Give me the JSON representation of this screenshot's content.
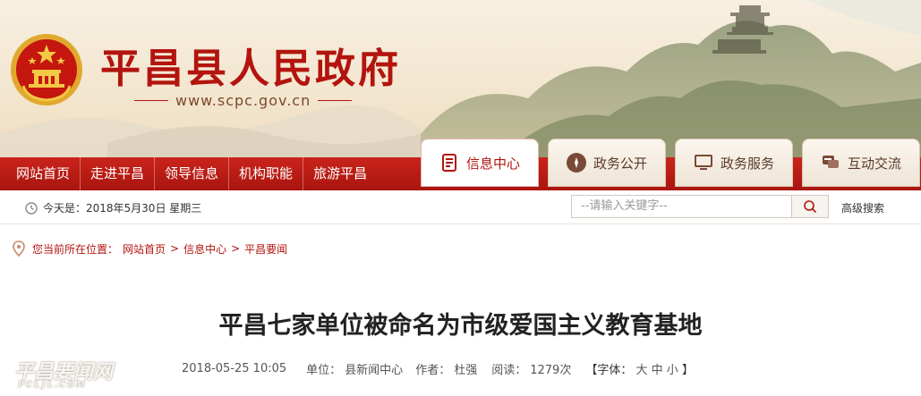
{
  "header": {
    "site_title": "平昌县人民政府",
    "site_url": "www.scpc.gov.cn"
  },
  "nav": {
    "links": [
      "网站首页",
      "走进平昌",
      "领导信息",
      "机构职能",
      "旅游平昌"
    ],
    "tabs": [
      {
        "label": "信息中心",
        "icon": "document-icon",
        "active": true
      },
      {
        "label": "政务公开",
        "icon": "compass-icon",
        "active": false
      },
      {
        "label": "政务服务",
        "icon": "monitor-icon",
        "active": false
      },
      {
        "label": "互动交流",
        "icon": "chat-icon",
        "active": false
      }
    ]
  },
  "utility": {
    "date_text": "今天是：2018年5月30日  星期三",
    "search_placeholder": "--请输入关键字--",
    "advanced_search": "高级搜索"
  },
  "breadcrumb": {
    "prefix": "您当前所在位置：",
    "items": [
      "网站首页",
      "信息中心",
      "平昌要闻"
    ],
    "separator": ">"
  },
  "article": {
    "title": "平昌七家单位被命名为市级爱国主义教育基地",
    "date": "2018-05-25 10:05",
    "unit_label": "单位：",
    "unit": "县新闻中心",
    "author_label": "作者：",
    "author": "杜强",
    "views_label": "阅读：",
    "views": "1279次",
    "font_label": "【字体：",
    "font_sizes": [
      "大",
      "中",
      "小"
    ],
    "font_close": "】"
  },
  "watermark": {
    "main": "平昌要闻网",
    "sub": "PCLJL.COM"
  },
  "colors": {
    "brand_red": "#b3140e",
    "nav_red": "#c9241b",
    "banner_bg": "#f3e6cf"
  }
}
